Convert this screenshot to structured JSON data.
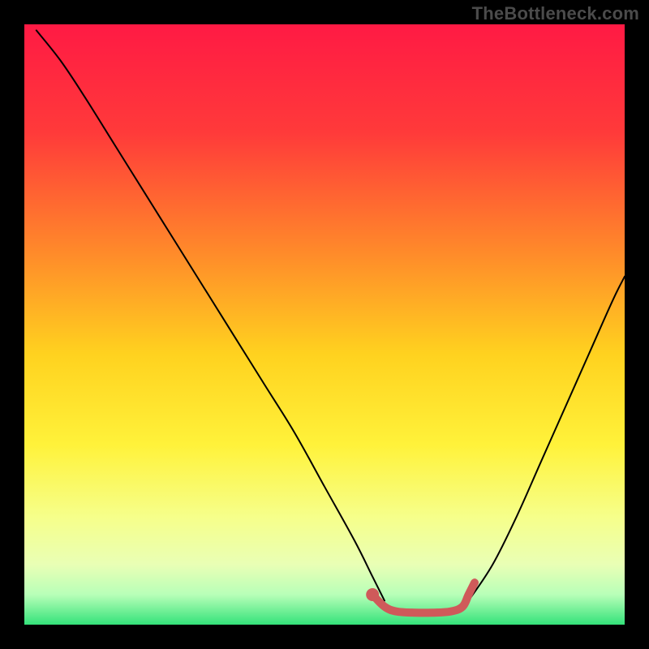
{
  "watermark": "TheBottleneck.com",
  "chart_data": {
    "type": "line",
    "title": "",
    "xlabel": "",
    "ylabel": "",
    "xlim": [
      0,
      100
    ],
    "ylim": [
      0,
      100
    ],
    "grid": false,
    "legend": false,
    "background_gradient_stops": [
      {
        "pct": 0,
        "color": "#ff1a44"
      },
      {
        "pct": 18,
        "color": "#ff3a3a"
      },
      {
        "pct": 38,
        "color": "#ff8a2a"
      },
      {
        "pct": 55,
        "color": "#ffd21f"
      },
      {
        "pct": 70,
        "color": "#fff23a"
      },
      {
        "pct": 82,
        "color": "#f6ff8a"
      },
      {
        "pct": 90,
        "color": "#e9ffb5"
      },
      {
        "pct": 95,
        "color": "#b8ffb8"
      },
      {
        "pct": 100,
        "color": "#34e27a"
      }
    ],
    "series": [
      {
        "name": "left-curve",
        "color": "#000000",
        "stroke_width": 2,
        "x": [
          2,
          6,
          10,
          15,
          20,
          25,
          30,
          35,
          40,
          45,
          50,
          55,
          58,
          60
        ],
        "values": [
          99,
          94,
          88,
          80,
          72,
          64,
          56,
          48,
          40,
          32,
          23,
          14,
          8,
          4
        ]
      },
      {
        "name": "right-curve",
        "color": "#000000",
        "stroke_width": 2,
        "x": [
          74,
          78,
          82,
          86,
          90,
          94,
          98,
          100
        ],
        "values": [
          4,
          10,
          18,
          27,
          36,
          45,
          54,
          58
        ]
      },
      {
        "name": "optimum-band",
        "color": "#cf5a5a",
        "stroke_width": 10,
        "x": [
          58,
          60,
          62,
          65,
          68,
          71,
          73,
          74,
          75
        ],
        "values": [
          5,
          3,
          2.2,
          2,
          2,
          2.2,
          3,
          5,
          7
        ]
      }
    ],
    "annotations": [
      {
        "name": "optimum-dot",
        "x": 58,
        "y": 5,
        "color": "#cf5a5a",
        "r": 8
      }
    ]
  }
}
